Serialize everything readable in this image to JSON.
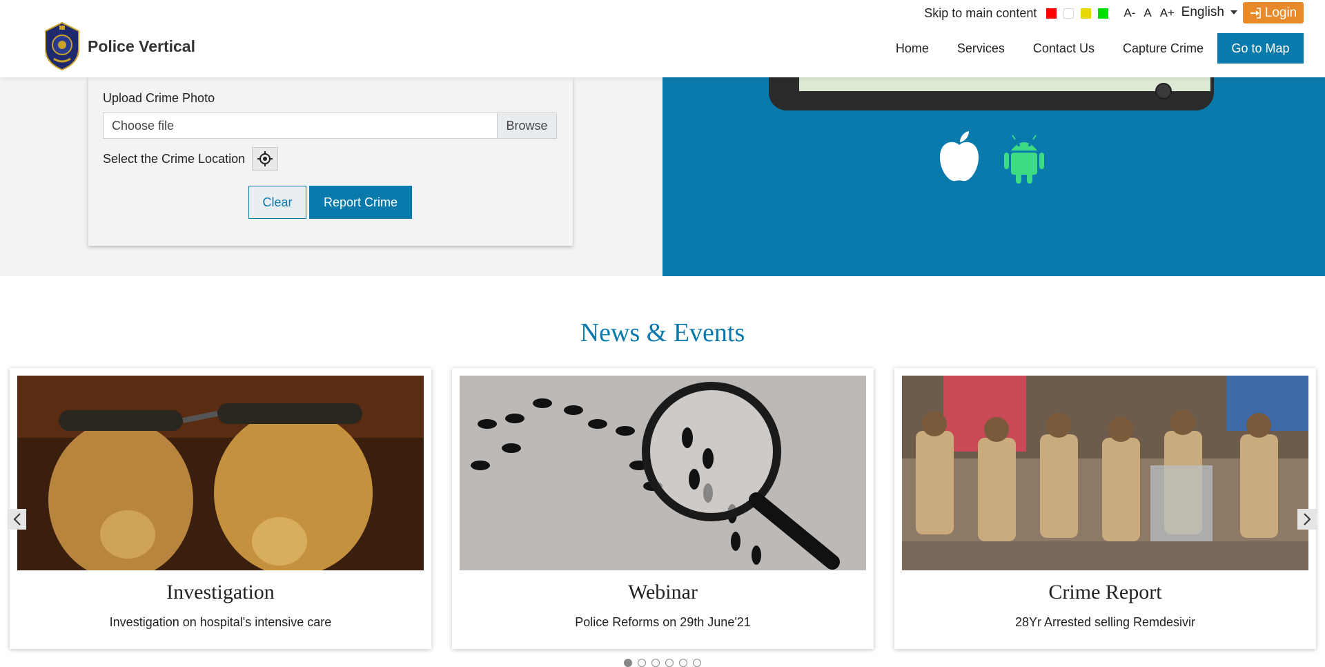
{
  "header": {
    "brand_name": "Police Vertical",
    "skip_link": "Skip to main content",
    "color_swatches": [
      "#ff0000",
      "#ffffff",
      "#e6d800",
      "#00dd00"
    ],
    "font_controls": [
      "A-",
      "A",
      "A+"
    ],
    "language": "English",
    "login_label": "Login",
    "nav": [
      "Home",
      "Services",
      "Contact Us",
      "Capture Crime"
    ],
    "map_button": "Go to Map"
  },
  "form": {
    "upload_label": "Upload Crime Photo",
    "file_placeholder": "Choose file",
    "browse_label": "Browse",
    "location_label": "Select the Crime Location",
    "clear_label": "Clear",
    "report_label": "Report Crime"
  },
  "news": {
    "title": "News & Events",
    "cards": [
      {
        "title": "Investigation",
        "desc": "Investigation on hospital's intensive care",
        "image": "handcuffs-image"
      },
      {
        "title": "Webinar",
        "desc": "Police Reforms on 29th June'21",
        "image": "footprints-magnifier-image"
      },
      {
        "title": "Crime Report",
        "desc": "28Yr Arrested selling Remdesivir",
        "image": "police-officers-image"
      }
    ],
    "page_count": 6,
    "active_page": 1
  },
  "colors": {
    "primary": "#0a7aad",
    "login": "#e8892a"
  }
}
